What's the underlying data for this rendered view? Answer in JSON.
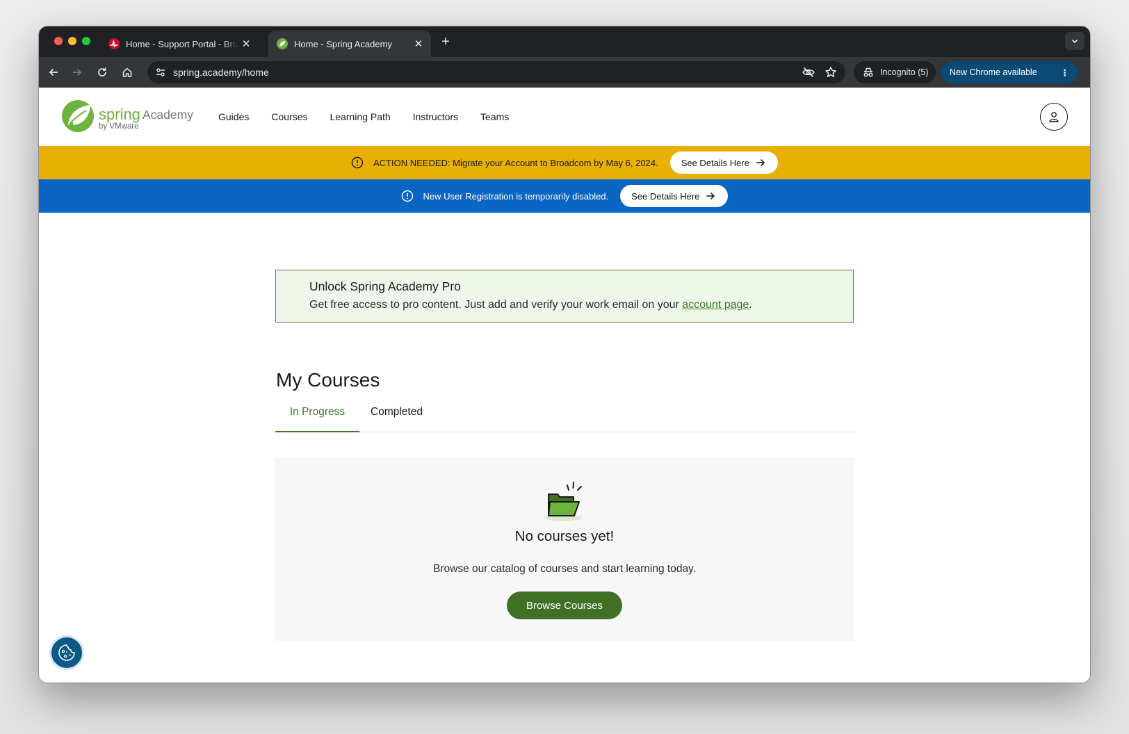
{
  "browser": {
    "tabs": [
      {
        "title": "Home - Support Portal - Broadcom",
        "active": false
      },
      {
        "title": "Home - Spring Academy",
        "active": true
      }
    ],
    "url": "spring.academy/home",
    "incognito_label": "Incognito (5)",
    "update_label": "New Chrome available",
    "update_color": "#0b4a75"
  },
  "site": {
    "logo": {
      "wordmark": "spring",
      "product": "Academy",
      "byline": "by VMware"
    },
    "nav": [
      "Guides",
      "Courses",
      "Learning Path",
      "Instructors",
      "Teams"
    ]
  },
  "banners": {
    "action": {
      "text": "ACTION NEEDED: Migrate your Account to Broadcom by May 6, 2024.",
      "button": "See Details Here",
      "color": "#e8b004"
    },
    "registration": {
      "text": "New User Registration is temporarily disabled.",
      "button": "See Details Here",
      "color": "#0a66c2"
    }
  },
  "pro": {
    "title": "Unlock Spring Academy Pro",
    "desc_before": "Get free access to pro content. Just add and verify your work email on your ",
    "link": "account page",
    "desc_after": "."
  },
  "courses": {
    "heading": "My Courses",
    "tabs": [
      "In Progress",
      "Completed"
    ],
    "active_tab": "In Progress",
    "empty_title": "No courses yet!",
    "empty_desc": "Browse our catalog of courses and start learning today.",
    "browse_button": "Browse Courses",
    "accent": "#3f7023"
  }
}
